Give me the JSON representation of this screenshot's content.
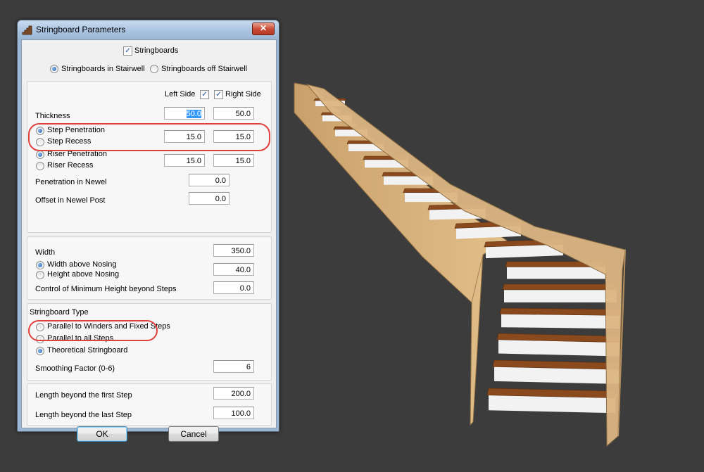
{
  "window": {
    "title": "Stringboard Parameters",
    "close_symbol": "✕"
  },
  "top": {
    "stringboards_label": "Stringboards",
    "stringboards_checked": true,
    "in_stairwell_label": "Stringboards in Stairwell",
    "off_stairwell_label": "Stringboards off Stairwell",
    "selected_location": "in_stairwell"
  },
  "sides": {
    "left_label": "Left Side",
    "left_checked": true,
    "right_label": "Right Side",
    "right_checked": true,
    "thickness_label": "Thickness",
    "thickness_left": "50.0",
    "thickness_right": "50.0",
    "step_penetration_label": "Step Penetration",
    "step_recess_label": "Step Recess",
    "step_left": "15.0",
    "step_right": "15.0",
    "riser_penetration_label": "Riser Penetration",
    "riser_recess_label": "Riser Recess",
    "riser_left": "15.0",
    "riser_right": "15.0",
    "penetration_newel_label": "Penetration in Newel",
    "penetration_newel_value": "0.0",
    "offset_newel_label": "Offset in Newel Post",
    "offset_newel_value": "0.0"
  },
  "dimensions": {
    "width_label": "Width",
    "width_value": "350.0",
    "width_above_nosing_label": "Width above Nosing",
    "height_above_nosing_label": "Height above Nosing",
    "nosing_value": "40.0",
    "min_height_label": "Control of Minimum Height beyond Steps",
    "min_height_value": "0.0"
  },
  "type": {
    "header": "Stringboard Type",
    "parallel_winders_label": "Parallel to Winders and Fixed Steps",
    "parallel_all_label": "Parallel to all Steps",
    "theoretical_label": "Theoretical Stringboard",
    "selected": "theoretical",
    "smoothing_label": "Smoothing Factor (0-6)",
    "smoothing_value": "6"
  },
  "lengths": {
    "first_label": "Length beyond the first Step",
    "first_value": "200.0",
    "last_label": "Length beyond the last Step",
    "last_value": "100.0"
  },
  "buttons": {
    "ok": "OK",
    "cancel": "Cancel"
  },
  "colors": {
    "highlight": "#e0413d",
    "background": "#3c3c3c",
    "stringer": "#d8b07a",
    "tread": "#8a4a1e",
    "riser": "#f2f2f2"
  }
}
